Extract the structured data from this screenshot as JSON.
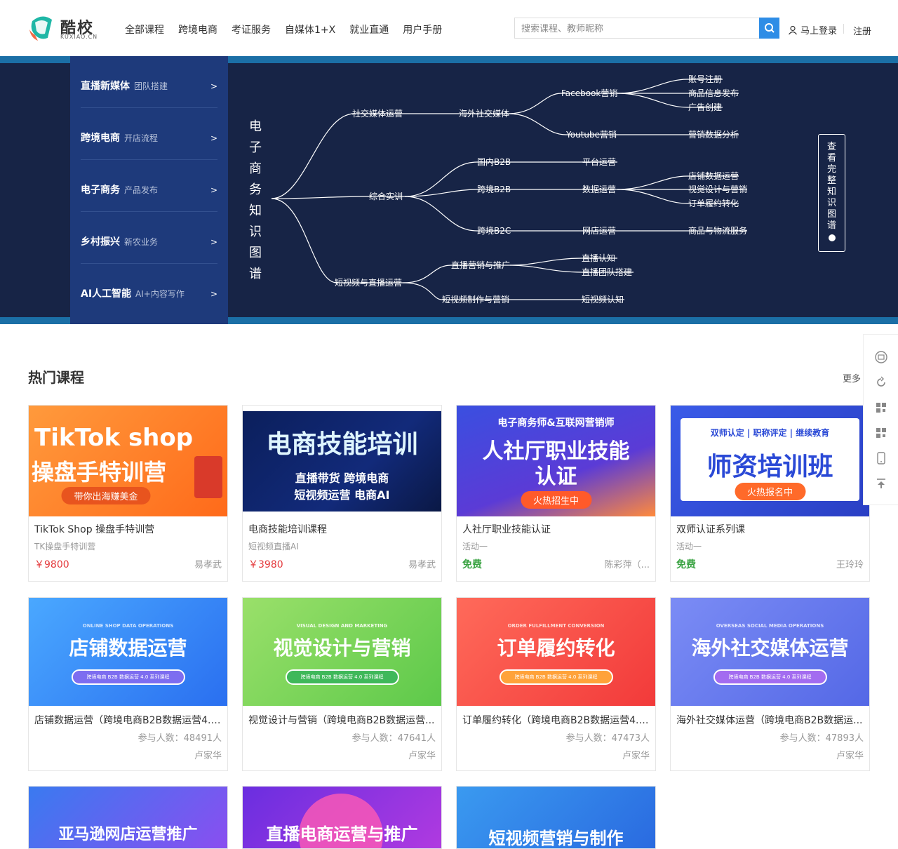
{
  "header": {
    "logo_text": "酷校",
    "logo_sub": "KUXIAO.CN",
    "nav": [
      "全部课程",
      "跨境电商",
      "考证服务",
      "自媒体1+X",
      "就业直通",
      "用户手册"
    ],
    "search_placeholder": "搜索课程、教师昵称",
    "login": "马上登录",
    "register": "注册"
  },
  "colors": {
    "accent": "#2e8de6",
    "banner_bg": "#172446",
    "menu_bg": "#1e3a7b",
    "price": "#e4393c",
    "free": "#39a342"
  },
  "categories": [
    {
      "title": "直播新媒体",
      "sub": "团队搭建",
      "arrow": ">"
    },
    {
      "title": "跨境电商",
      "sub": "开店流程",
      "arrow": ">"
    },
    {
      "title": "电子商务",
      "sub": "产品发布",
      "arrow": ">"
    },
    {
      "title": "乡村振兴",
      "sub": "新农业务",
      "arrow": ">"
    },
    {
      "title": "AI人工智能",
      "sub": "AI+内容写作",
      "arrow": ">"
    }
  ],
  "knowledge_map": {
    "title": "电子商务知识图谱",
    "nodes": {
      "social": "社交媒体运营",
      "overseas_social": "海外社交媒体",
      "facebook": "Facebook营销",
      "youtube": "Youtube营销",
      "account": "账号注册",
      "product_info": "商品信息发布",
      "ad": "广告创建",
      "data_analysis": "营销数据分析",
      "practice": "综合实训",
      "domestic_b2b": "国内B2B",
      "cross_b2b": "跨境B2B",
      "cross_b2c": "跨境B2C",
      "platform_ops": "平台运营",
      "data_ops": "数据运营",
      "shop_ops": "网店运营",
      "shop_data": "店铺数据运营",
      "visual": "视觉设计与营销",
      "order": "订单履约转化",
      "logistics": "商品与物流服务",
      "shortvideo_live": "短视频与直播运营",
      "live_marketing": "直播营销与推广",
      "short_video_make": "短视频制作与营销",
      "live_know": "直播认知",
      "live_team": "直播团队搭建",
      "sv_know": "短视频认知"
    },
    "full_map_button": "查看完整知识图谱"
  },
  "section": {
    "title": "热门课程",
    "more": "更多"
  },
  "courses_row1": [
    {
      "title": "TikTok Shop 操盘手特训营",
      "sub": "TK操盘手特训营",
      "price": "￥9800",
      "teacher": "易孝武",
      "img_line1": "TikTok shop",
      "img_line2": "操盘手特训营",
      "img_pill": "带你出海赚美金"
    },
    {
      "title": "电商技能培训课程",
      "sub": "短视频直播AI",
      "price": "￥3980",
      "teacher": "易孝武",
      "img_line1": "电商技能培训",
      "img_line2": "直播带货  跨境电商",
      "img_line3": "短视频运营  电商AI"
    },
    {
      "title": "人社厅职业技能认证",
      "sub": "活动一",
      "price": "免费",
      "teacher": "陈彩萍（...",
      "img_top": "电子商务师&互联网营销师",
      "img_line1": "人社厅职业技能",
      "img_line2": "认证",
      "img_pill": "火热招生中"
    },
    {
      "title": "双师认证系列课",
      "sub": "活动一",
      "price": "免费",
      "teacher": "王玲玲",
      "img_top": "双师认定 | 职称评定 | 继续教育",
      "img_line1": "师资培训班",
      "img_pill": "火热报名中"
    }
  ],
  "courses_row2": [
    {
      "title": "店铺数据运营（跨境电商B2B数据运营4.0...",
      "count": "参与人数：48491人",
      "teacher": "卢家华",
      "img_en": "ONLINE SHOP DATA OPERATIONS",
      "img_line1": "店铺数据运营",
      "img_pill": "跨境电商 B2B 数据运营 4.0 系列课程"
    },
    {
      "title": "视觉设计与营销（跨境电商B2B数据运营...",
      "count": "参与人数：47641人",
      "teacher": "卢家华",
      "img_en": "VISUAL DESIGN AND MARKETING",
      "img_line1": "视觉设计与营销",
      "img_pill": "跨境电商 B2B 数据运营 4.0 系列课程"
    },
    {
      "title": "订单履约转化（跨境电商B2B数据运营4.0...",
      "count": "参与人数：47473人",
      "teacher": "卢家华",
      "img_en": "ORDER FULFILLMENT CONVERSION",
      "img_line1": "订单履约转化",
      "img_pill": "跨境电商 B2B 数据运营 4.0 系列课程"
    },
    {
      "title": "海外社交媒体运营（跨境电商B2B数据运...",
      "count": "参与人数：47893人",
      "teacher": "卢家华",
      "img_en": "OVERSEAS SOCIAL MEDIA OPERATIONS",
      "img_line1": "海外社交媒体运营",
      "img_pill": "跨境电商 B2B 数据运营 4.0 系列课程"
    }
  ],
  "courses_row3": [
    {
      "img_line1": "亚马逊网店运营推广"
    },
    {
      "img_line1": "直播电商运营与推广"
    },
    {
      "img_line1": "短视频营销与制作"
    }
  ],
  "toolbar_icons": [
    "customer-service-icon",
    "refresh-icon",
    "qrcode-icon",
    "qrcode-alt-icon",
    "mobile-icon",
    "back-to-top-icon"
  ]
}
